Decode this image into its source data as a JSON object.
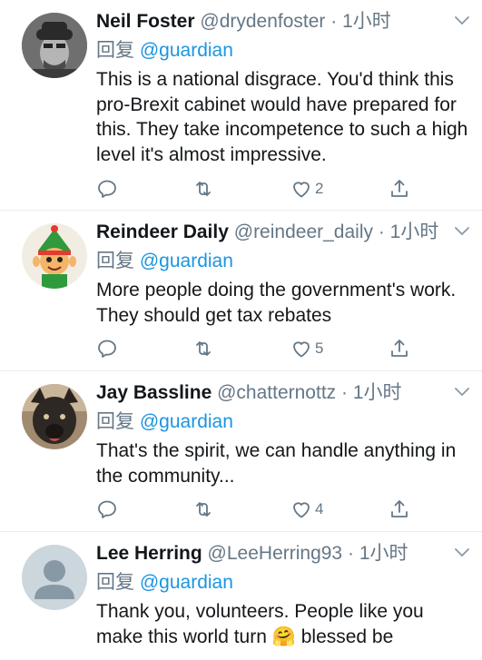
{
  "tweets": [
    {
      "name": "Neil Foster",
      "handle": "@drydenfoster",
      "dot": "·",
      "time": "1小时",
      "reply_prefix": "回复",
      "reply_to": "@guardian",
      "text": "This is a national disgrace. You'd think this pro-Brexit cabinet would have prepared for this. They take incompetence to such a high level it's almost impressive.",
      "likes": "2"
    },
    {
      "name": "Reindeer Daily",
      "handle": "@reindeer_daily",
      "dot": "·",
      "time": "1小时",
      "reply_prefix": "回复",
      "reply_to": "@guardian",
      "text": "More people doing the government's work. They should get tax rebates",
      "likes": "5"
    },
    {
      "name": "Jay Bassline",
      "handle": "@chatternottz",
      "dot": "·",
      "time": "1小时",
      "reply_prefix": "回复",
      "reply_to": "@guardian",
      "text": "That's the spirit, we can handle anything in the community...",
      "likes": "4"
    },
    {
      "name": "Lee Herring",
      "handle": "@LeeHerring93",
      "dot": "·",
      "time": "1小时",
      "reply_prefix": "回复",
      "reply_to": "@guardian",
      "text": "Thank you, volunteers. People like you make this world turn 🤗 blessed be",
      "likes": ""
    }
  ],
  "colors": {
    "link": "#1b95e0",
    "muted": "#657786",
    "text": "#14171a",
    "divider": "#e6ecf0"
  },
  "icons": [
    "reply-icon",
    "retweet-icon",
    "like-icon",
    "share-icon",
    "chevron-down-icon"
  ]
}
